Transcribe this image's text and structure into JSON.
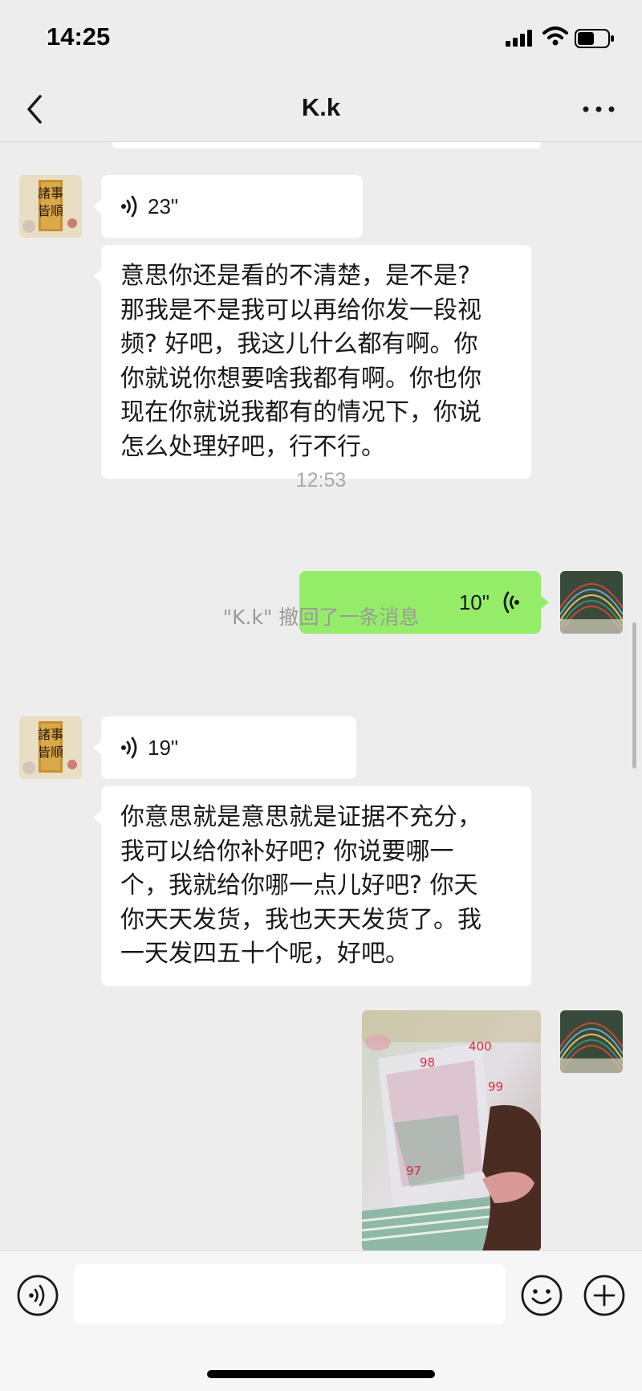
{
  "status_bar": {
    "time": "14:25",
    "battery_level": 0.55
  },
  "nav": {
    "title": "K.k"
  },
  "messages": [
    {
      "type": "voice",
      "side": "left",
      "duration": "23\""
    },
    {
      "type": "text",
      "side": "left",
      "lines": [
        "意思你还是看的不清楚，是不是?",
        "那我是不是我可以再给你发一段视",
        "频? 好吧，我这儿什么都有啊。你",
        "你就说你想要啥我都有啊。你也你",
        "现在你就说我都有的情况下，你说",
        "怎么处理好吧，行不行。"
      ]
    },
    {
      "type": "timestamp",
      "text": "12:53"
    },
    {
      "type": "voice",
      "side": "right",
      "duration": "10\""
    },
    {
      "type": "system",
      "text": "\"K.k\" 撤回了一条消息"
    },
    {
      "type": "voice",
      "side": "left",
      "duration": "19\""
    },
    {
      "type": "text",
      "side": "left",
      "lines": [
        "你意思就是意思就是证据不充分，",
        "我可以给你补好吧? 你说要哪一",
        "个，我就给你哪一点儿好吧? 你天",
        "你天天发货，我也天天发货了。我",
        "一天发四五十个呢，好吧。"
      ]
    },
    {
      "type": "image",
      "side": "right",
      "labels": [
        "98",
        "400",
        "99",
        "97"
      ]
    }
  ],
  "avatar_left_text": "諸事皆順",
  "input": {
    "placeholder": ""
  },
  "colors": {
    "background": "#ededed",
    "sent_bubble": "#95ec69",
    "received_bubble": "#ffffff"
  }
}
